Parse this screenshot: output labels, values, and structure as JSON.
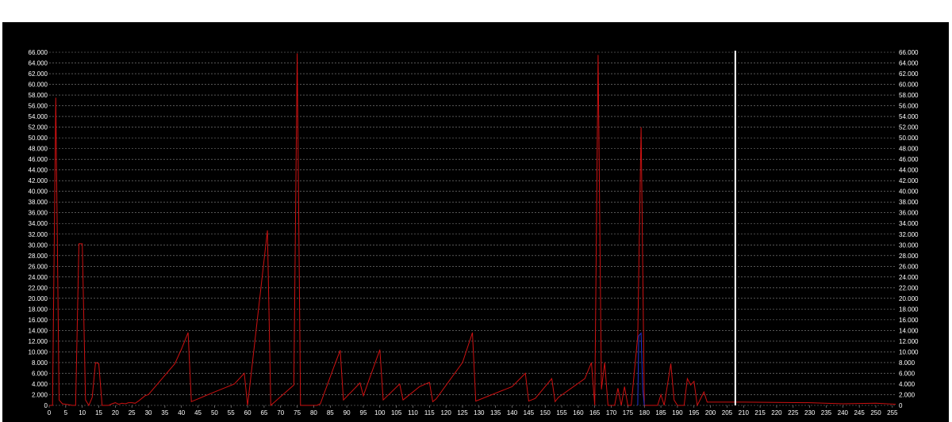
{
  "chart_data": {
    "type": "line",
    "title": "",
    "xlabel": "",
    "ylabel": "",
    "xlim": [
      0,
      256
    ],
    "ylim": [
      0,
      66000
    ],
    "grid": true,
    "legend": "none",
    "x_ticks": [
      0,
      5,
      10,
      15,
      20,
      25,
      30,
      35,
      40,
      45,
      50,
      55,
      60,
      65,
      70,
      75,
      80,
      85,
      90,
      95,
      100,
      105,
      110,
      115,
      120,
      125,
      130,
      135,
      140,
      145,
      150,
      155,
      160,
      165,
      170,
      175,
      180,
      185,
      190,
      195,
      200,
      205,
      210,
      215,
      220,
      225,
      230,
      235,
      240,
      245,
      250,
      255
    ],
    "y_ticks": [
      "0",
      "2.000",
      "4.000",
      "6.000",
      "8.000",
      "10.000",
      "12.000",
      "14.000",
      "16.000",
      "18.000",
      "20.000",
      "22.000",
      "24.000",
      "26.000",
      "28.000",
      "30.000",
      "32.000",
      "34.000",
      "36.000",
      "38.000",
      "40.000",
      "42.000",
      "44.000",
      "46.000",
      "48.000",
      "50.000",
      "52.000",
      "54.000",
      "56.000",
      "58.000",
      "60.000",
      "62.000",
      "64.000",
      "66.000"
    ],
    "series": [
      {
        "color": "#cc1111",
        "points": [
          [
            0,
            0
          ],
          [
            1,
            0
          ],
          [
            2,
            57500
          ],
          [
            3,
            1000
          ],
          [
            4,
            300
          ],
          [
            5,
            200
          ],
          [
            6,
            100
          ],
          [
            7,
            0
          ],
          [
            8,
            0
          ],
          [
            9,
            30200
          ],
          [
            10,
            30200
          ],
          [
            11,
            1000
          ],
          [
            12,
            0
          ],
          [
            13,
            1500
          ],
          [
            14,
            8000
          ],
          [
            15,
            7800
          ],
          [
            16,
            0
          ],
          [
            17,
            0
          ],
          [
            18,
            0
          ],
          [
            19,
            300
          ],
          [
            20,
            500
          ],
          [
            21,
            200
          ],
          [
            22,
            400
          ],
          [
            23,
            300
          ],
          [
            24,
            500
          ],
          [
            25,
            500
          ],
          [
            26,
            400
          ],
          [
            27,
            800
          ],
          [
            28,
            1300
          ],
          [
            29,
            1800
          ],
          [
            30,
            2000
          ],
          [
            38,
            7800
          ],
          [
            40,
            10500
          ],
          [
            42,
            13600
          ],
          [
            43,
            700
          ],
          [
            50,
            2500
          ],
          [
            56,
            4000
          ],
          [
            59,
            6000
          ],
          [
            60,
            0
          ],
          [
            66,
            32700
          ],
          [
            67,
            0
          ],
          [
            74,
            3800
          ],
          [
            75,
            65800
          ],
          [
            76,
            0
          ],
          [
            77,
            0
          ],
          [
            81,
            0
          ],
          [
            82,
            300
          ],
          [
            86,
            7000
          ],
          [
            88,
            10300
          ],
          [
            89,
            1000
          ],
          [
            94,
            4200
          ],
          [
            95,
            1800
          ],
          [
            100,
            10400
          ],
          [
            101,
            1000
          ],
          [
            106,
            4000
          ],
          [
            107,
            1000
          ],
          [
            112,
            3500
          ],
          [
            115,
            4300
          ],
          [
            116,
            700
          ],
          [
            117,
            1200
          ],
          [
            125,
            8000
          ],
          [
            128,
            13600
          ],
          [
            129,
            800
          ],
          [
            140,
            3500
          ],
          [
            144,
            6000
          ],
          [
            145,
            800
          ],
          [
            147,
            1300
          ],
          [
            152,
            5000
          ],
          [
            153,
            700
          ],
          [
            154,
            1500
          ],
          [
            162,
            5000
          ],
          [
            164,
            8000
          ],
          [
            165,
            0
          ],
          [
            166,
            65500
          ],
          [
            167,
            3000
          ],
          [
            168,
            8000
          ],
          [
            169,
            0
          ],
          [
            171,
            0
          ],
          [
            172,
            3200
          ],
          [
            173,
            0
          ],
          [
            174,
            3500
          ],
          [
            175,
            0
          ],
          [
            176,
            0
          ],
          [
            178,
            13000
          ],
          [
            179,
            52000
          ],
          [
            180,
            0
          ],
          [
            184,
            0
          ],
          [
            185,
            2000
          ],
          [
            186,
            0
          ],
          [
            188,
            7800
          ],
          [
            189,
            1000
          ],
          [
            190,
            0
          ],
          [
            192,
            0
          ],
          [
            193,
            5000
          ],
          [
            194,
            3800
          ],
          [
            195,
            4500
          ],
          [
            196,
            0
          ],
          [
            198,
            2500
          ],
          [
            199,
            600
          ],
          [
            210,
            600
          ],
          [
            230,
            500
          ],
          [
            240,
            300
          ],
          [
            250,
            400
          ],
          [
            256,
            200
          ]
        ]
      },
      {
        "color": "#2233cc",
        "points": [
          [
            178,
            0
          ],
          [
            178.3,
            13000
          ],
          [
            179,
            13500
          ],
          [
            179.5,
            3000
          ],
          [
            180,
            0
          ]
        ]
      }
    ],
    "annotations": [
      {
        "type": "vertical_marker",
        "x": 207.5,
        "color": "#ffffff"
      }
    ]
  }
}
